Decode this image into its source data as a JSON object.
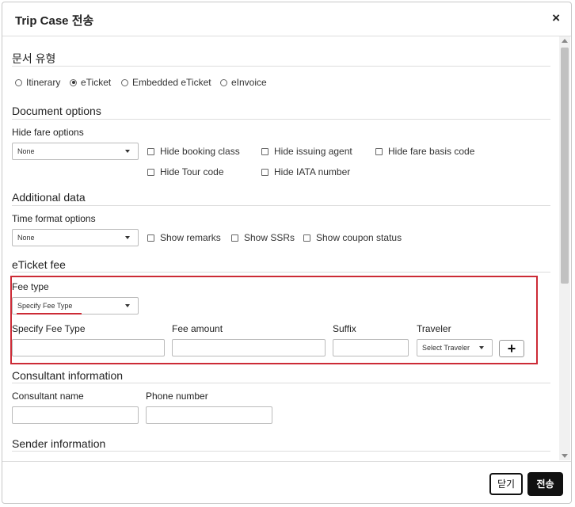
{
  "dialog": {
    "title": "Trip Case 전송",
    "close_glyph": "×"
  },
  "doc_type": {
    "title": "문서 유형",
    "options": [
      {
        "label": "Itinerary",
        "checked": false
      },
      {
        "label": "eTicket",
        "checked": true
      },
      {
        "label": "Embedded eTicket",
        "checked": false
      },
      {
        "label": "eInvoice",
        "checked": false
      }
    ]
  },
  "document_options": {
    "title": "Document options",
    "hide_fare_label": "Hide fare options",
    "hide_fare_value": "None",
    "checks": [
      "Hide booking class",
      "Hide issuing agent",
      "Hide fare basis code",
      "Hide Tour code",
      "Hide IATA number"
    ]
  },
  "additional_data": {
    "title": "Additional data",
    "time_format_label": "Time format options",
    "time_format_value": "None",
    "checks": [
      "Show remarks",
      "Show SSRs",
      "Show coupon status"
    ]
  },
  "eticket_fee": {
    "title": "eTicket fee",
    "fee_type_label": "Fee type",
    "fee_type_value": "Specify Fee Type",
    "col_specify": "Specify Fee Type",
    "col_amount": "Fee amount",
    "col_suffix": "Suffix",
    "col_traveler": "Traveler",
    "traveler_value": "Select Traveler",
    "add_glyph": "+"
  },
  "consultant": {
    "title": "Consultant information",
    "name_label": "Consultant name",
    "phone_label": "Phone number"
  },
  "sender": {
    "title": "Sender information"
  },
  "footer": {
    "close_label": "닫기",
    "send_label": "전송"
  },
  "colors": {
    "highlight": "#cc2b36",
    "primary_button": "#111111"
  }
}
